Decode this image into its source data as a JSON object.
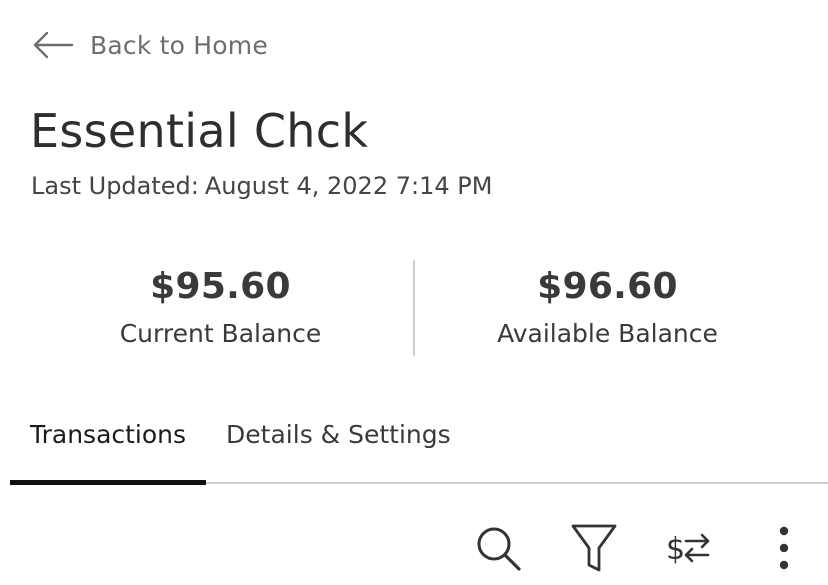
{
  "nav": {
    "back_label": "Back to Home"
  },
  "account": {
    "name": "Essential Chck",
    "last_updated_label": "Last Updated:",
    "last_updated_value": "August 4, 2022 7:14 PM"
  },
  "balances": {
    "current": {
      "amount": "$95.60",
      "label": "Current Balance"
    },
    "available": {
      "amount": "$96.60",
      "label": "Available Balance"
    }
  },
  "tabs": [
    {
      "label": "Transactions",
      "active": true
    },
    {
      "label": "Details & Settings",
      "active": false
    }
  ],
  "toolbar": {
    "icons": [
      "search-icon",
      "filter-icon",
      "transfer-dollar-icon",
      "more-vertical-icon"
    ]
  },
  "colors": {
    "text_primary": "#2e2e2e",
    "text_muted": "#6e6e6e",
    "divider": "#d8c9c9",
    "active_tab_underline": "#111111"
  }
}
